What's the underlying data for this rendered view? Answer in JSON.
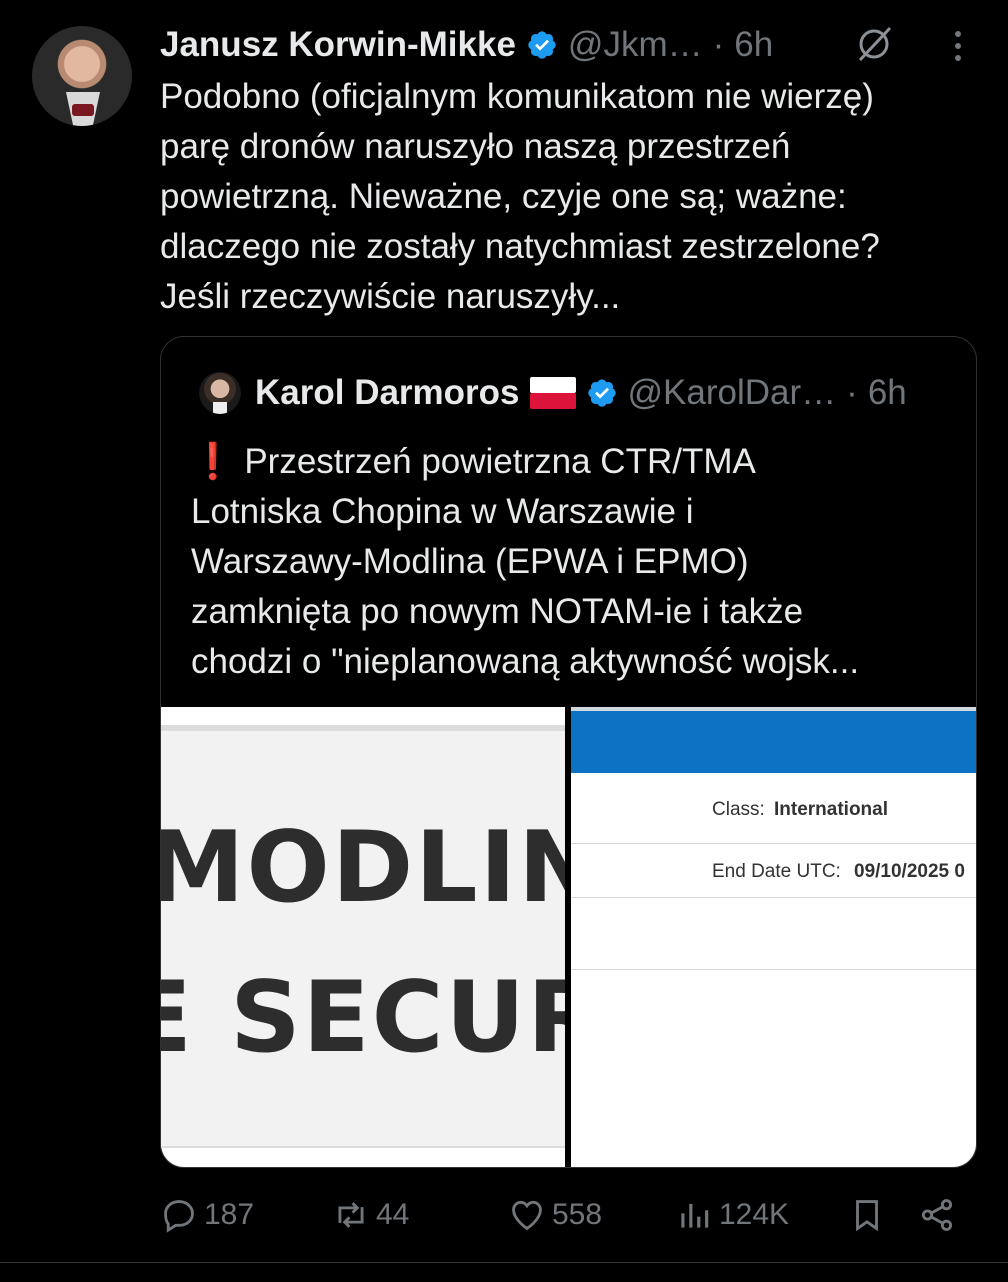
{
  "author": {
    "name": "Janusz Korwin-Mikke",
    "handle": "@Jkm…",
    "separator": "·",
    "time": "6h"
  },
  "text": "Podobno (oficjalnym komunikatom nie wierzę)\nparę dronów naruszyło naszą przestrzeń\npowietrzną. Nieważne, czyje one są; ważne:\ndlaczego nie zostały natychmiast zestrzelone?\nJeśli rzeczywiście naruszyły...",
  "quote": {
    "name": "Karol Darmoros",
    "flag": "poland-flag",
    "handle": "@KarolDar…",
    "separator": "·",
    "time": "6h",
    "excl": "❗",
    "text": " Przestrzeń powietrzna CTR/TMA\nLotniska Chopina w Warszawie i\nWarszawy-Modlina (EPWA i EPMO)\nzamknięta po nowym NOTAM-ie i także\nchodzi o \"nieplanowaną aktywność wojsk...",
    "media_left": {
      "line1": "MODLIN",
      "line2": "E SECUR"
    },
    "media_right": {
      "class_label": "Class:",
      "class_value": "International",
      "end_label": "End Date UTC:",
      "end_value": "09/10/2025 0"
    }
  },
  "actions": {
    "replies": "187",
    "reposts": "44",
    "likes": "558",
    "views": "124K"
  },
  "colors": {
    "background": "#000000",
    "text": "#e7e9ea",
    "muted": "#71767b",
    "verified": "#1d9bf0",
    "border": "#2f3336"
  }
}
